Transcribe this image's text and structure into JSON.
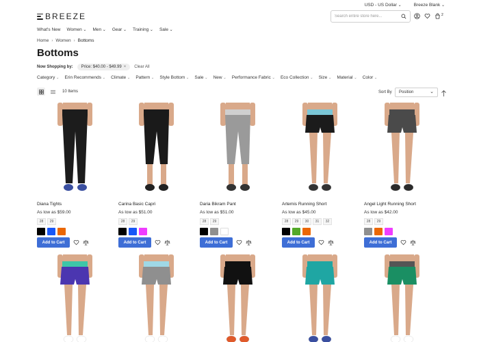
{
  "topbar": {
    "currency": "USD - US Dollar",
    "store": "Breeze Blank"
  },
  "header": {
    "logo_text": "BREEZE",
    "search_placeholder": "Search entire store here...",
    "cart_count": "2"
  },
  "nav": [
    "What's New",
    "Women",
    "Men",
    "Gear",
    "Training",
    "Sale"
  ],
  "breadcrumb": [
    "Home",
    "Women",
    "Bottoms"
  ],
  "page_title": "Bottoms",
  "now_shopping": {
    "label": "Now Shopping by:",
    "chip": "Price: $40.00 - $49.99",
    "clear": "Clear All"
  },
  "filters": [
    "Category",
    "Erin Recommends",
    "Climate",
    "Pattern",
    "Style Bottom",
    "Sale",
    "New",
    "Performance Fabric",
    "Eco Collection",
    "Size",
    "Material",
    "Color"
  ],
  "toolbar": {
    "count": "10 Items",
    "sort_label": "Sort By",
    "sort_value": "Position"
  },
  "add_to_cart": "Add to Cart",
  "colors": {
    "accent": "#3e6ed6"
  },
  "products": [
    {
      "name": "Diana Tights",
      "price": "As low as $59.00",
      "sizes": [
        "28",
        "29"
      ],
      "swatches": [
        "#000000",
        "#1857f7",
        "#eb6703"
      ],
      "pants": "#1c1c1c",
      "band": "#1c1c1c",
      "length": "full",
      "shoes": "#3a4fa0"
    },
    {
      "name": "Carina Basic Capri",
      "price": "As low as $51.00",
      "sizes": [
        "28",
        "29"
      ],
      "swatches": [
        "#000000",
        "#1857f7",
        "#ef3dff"
      ],
      "pants": "#1a1a1a",
      "band": "#1a1a1a",
      "length": "capri",
      "shoes": "#222222"
    },
    {
      "name": "Daria Bikram Pant",
      "price": "As low as $51.00",
      "sizes": [
        "28",
        "29"
      ],
      "swatches": [
        "#000000",
        "#8f8f8f",
        "#ffffff"
      ],
      "pants": "#9a9a9a",
      "band": "#cfcfcf",
      "length": "capri",
      "shoes": "#333333"
    },
    {
      "name": "Artemis Running Short",
      "price": "As low as $45.00",
      "sizes": [
        "28",
        "29",
        "30",
        "31",
        "32"
      ],
      "swatches": [
        "#000000",
        "#53a828",
        "#eb6703"
      ],
      "pants": "#1b1b1b",
      "band": "#7ac6d6",
      "length": "short",
      "shoes": "#333333"
    },
    {
      "name": "Angel Light Running Short",
      "price": "As low as $42.00",
      "sizes": [
        "28",
        "29"
      ],
      "swatches": [
        "#8f8f8f",
        "#eb6703",
        "#ef3dff"
      ],
      "pants": "#4a4a4a",
      "band": "#4a4a4a",
      "length": "short",
      "shoes": "#2b2b2b"
    },
    {
      "name": "",
      "price": "",
      "sizes": [],
      "swatches": [],
      "pants": "#4b36b0",
      "band": "#3ec6a8",
      "length": "short",
      "shoes": "#ffffff"
    },
    {
      "name": "",
      "price": "",
      "sizes": [],
      "swatches": [],
      "pants": "#8f8f8f",
      "band": "#9fd8e6",
      "length": "short",
      "shoes": "#ffffff"
    },
    {
      "name": "",
      "price": "",
      "sizes": [],
      "swatches": [],
      "pants": "#111111",
      "band": "#111111",
      "length": "short",
      "shoes": "#e05a2b"
    },
    {
      "name": "",
      "price": "",
      "sizes": [],
      "swatches": [],
      "pants": "#1fa6a3",
      "band": "#1fa6a3",
      "length": "short",
      "shoes": "#3a4fa0"
    },
    {
      "name": "",
      "price": "",
      "sizes": [],
      "swatches": [],
      "pants": "#1a8f63",
      "band": "#555555",
      "length": "short",
      "shoes": "#ffffff"
    }
  ]
}
